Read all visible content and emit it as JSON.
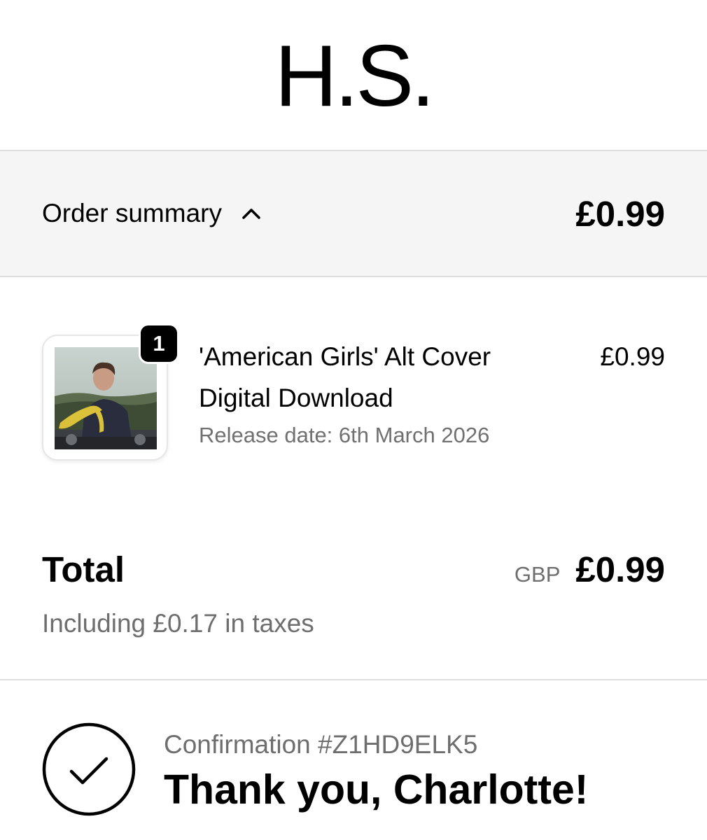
{
  "brand": {
    "logo_text": "H.S."
  },
  "summary": {
    "label": "Order summary",
    "toggle_icon": "chevron-up-icon",
    "price": "£0.99"
  },
  "item": {
    "quantity": "1",
    "title_line1": "'American Girls' Alt Cover",
    "title_line2": "Digital Download",
    "release_date": "Release date: 6th March 2026",
    "price": "£0.99"
  },
  "total": {
    "label": "Total",
    "currency": "GBP",
    "price": "£0.99",
    "taxes": "Including £0.17 in taxes"
  },
  "confirmation": {
    "icon": "checkmark-circle-icon",
    "number": "Confirmation #Z1HD9ELK5",
    "thanks": "Thank you, Charlotte!"
  }
}
